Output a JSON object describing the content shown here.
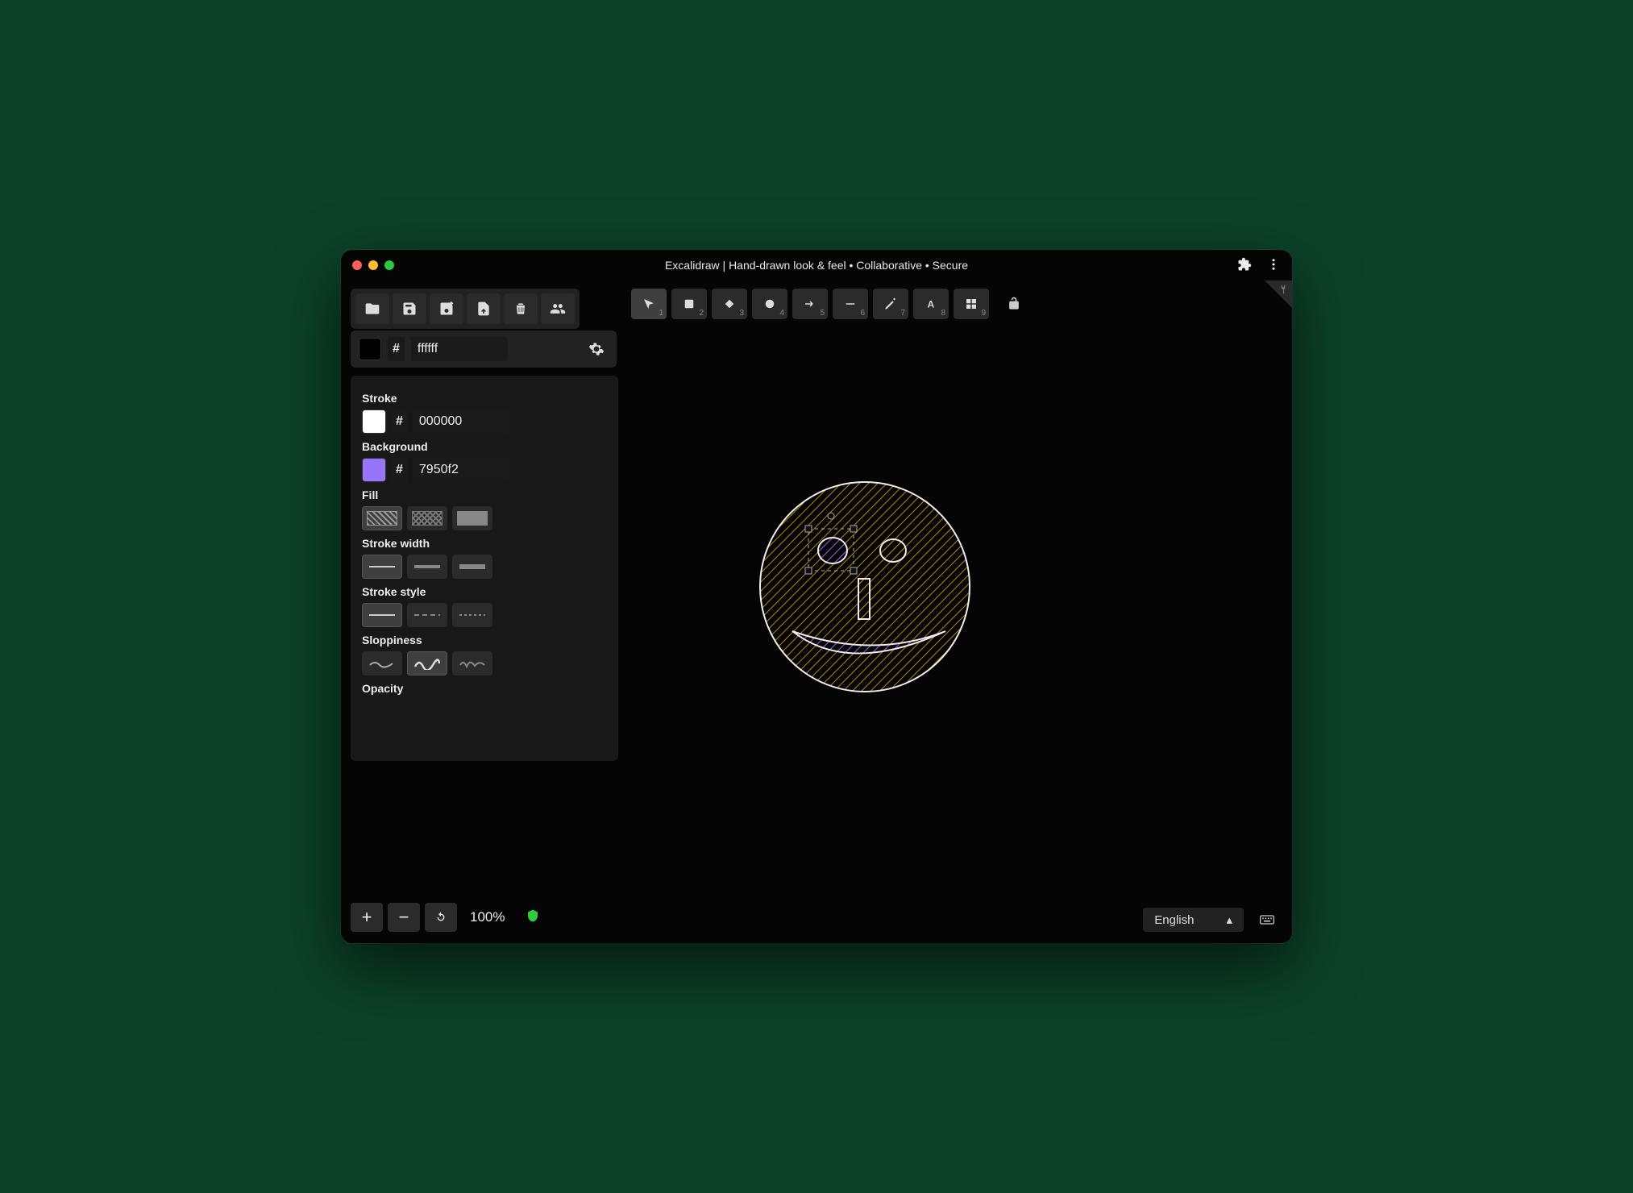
{
  "window": {
    "title": "Excalidraw | Hand-drawn look & feel • Collaborative • Secure"
  },
  "filebar": {
    "tools": [
      {
        "name": "open-file-button",
        "icon": "folder-open"
      },
      {
        "name": "save-file-button",
        "icon": "save"
      },
      {
        "name": "save-as-button",
        "icon": "save-edit"
      },
      {
        "name": "export-button",
        "icon": "export"
      },
      {
        "name": "clear-canvas-button",
        "icon": "trash"
      },
      {
        "name": "collaborate-button",
        "icon": "users"
      }
    ]
  },
  "canvas_bg": {
    "hash": "#",
    "value": "ffffff",
    "swatch_color": "#000000"
  },
  "toolbar": {
    "items": [
      {
        "name": "selection-tool",
        "icon": "cursor",
        "key": "1"
      },
      {
        "name": "rectangle-tool",
        "icon": "square",
        "key": "2"
      },
      {
        "name": "diamond-tool",
        "icon": "diamond",
        "key": "3"
      },
      {
        "name": "ellipse-tool",
        "icon": "circle",
        "key": "4"
      },
      {
        "name": "arrow-tool",
        "icon": "arrow",
        "key": "5"
      },
      {
        "name": "line-tool",
        "icon": "line",
        "key": "6"
      },
      {
        "name": "draw-tool",
        "icon": "pencil",
        "key": "7"
      },
      {
        "name": "text-tool",
        "icon": "text",
        "key": "8"
      },
      {
        "name": "library-tool",
        "icon": "grid",
        "key": "9"
      }
    ],
    "lock": {
      "name": "lock-tool-toggle"
    }
  },
  "side_panel": {
    "stroke": {
      "label": "Stroke",
      "swatch_color": "#ffffff",
      "hash": "#",
      "value": "000000"
    },
    "background": {
      "label": "Background",
      "swatch_color": "#9775fa",
      "hash": "#",
      "value": "7950f2"
    },
    "fill": {
      "label": "Fill",
      "options": [
        {
          "name": "fill-hachure",
          "selected": true
        },
        {
          "name": "fill-cross",
          "selected": false
        },
        {
          "name": "fill-solid",
          "selected": false
        }
      ]
    },
    "stroke_width": {
      "label": "Stroke width",
      "options": [
        {
          "name": "stroke-thin",
          "selected": true
        },
        {
          "name": "stroke-medium",
          "selected": false
        },
        {
          "name": "stroke-thick",
          "selected": false
        }
      ]
    },
    "stroke_style": {
      "label": "Stroke style",
      "options": [
        {
          "name": "stroke-style-solid",
          "selected": true
        },
        {
          "name": "stroke-style-dashed",
          "selected": false
        },
        {
          "name": "stroke-style-dotted",
          "selected": false
        }
      ]
    },
    "sloppiness": {
      "label": "Sloppiness",
      "options": [
        {
          "name": "sloppiness-architect",
          "selected": false
        },
        {
          "name": "sloppiness-artist",
          "selected": true
        },
        {
          "name": "sloppiness-cartoonist",
          "selected": false
        }
      ]
    },
    "opacity": {
      "label": "Opacity"
    }
  },
  "bottom": {
    "zoom": "100%",
    "language": "English"
  }
}
